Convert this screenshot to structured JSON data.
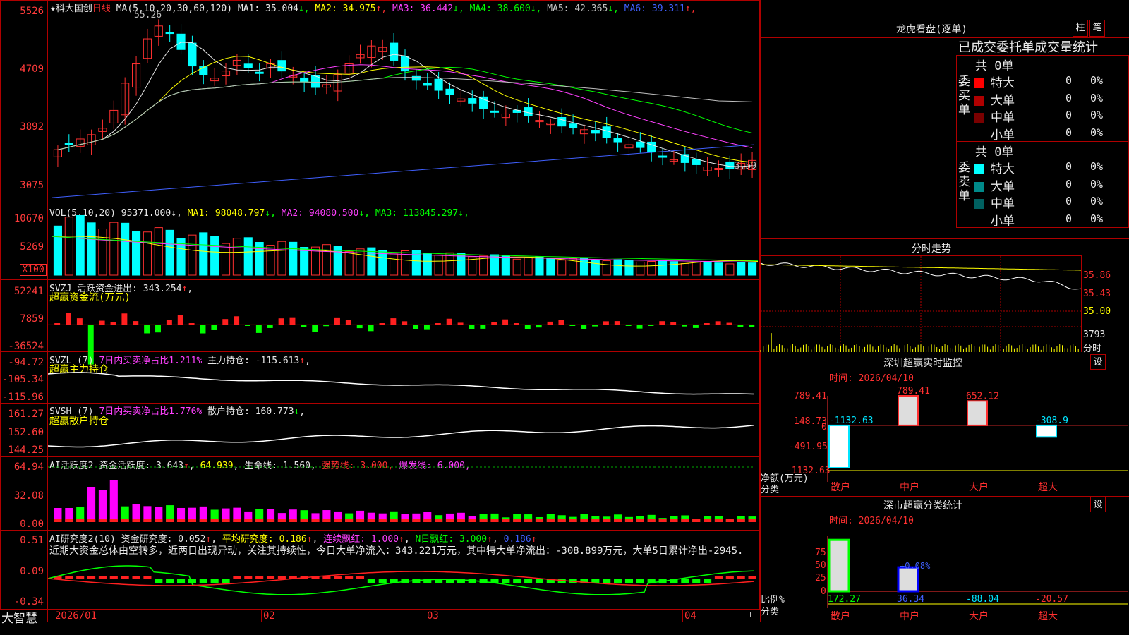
{
  "kline": {
    "star": "★",
    "name": "科大国创",
    "period": "日线",
    "ma_label": "MA(5,10,20,30,60,120)",
    "ma": [
      {
        "label": "MA1:",
        "value": "35.004",
        "arrow": "↓",
        "color": "#e8e8e8"
      },
      {
        "label": "MA2:",
        "value": "34.975",
        "arrow": "↑",
        "color": "#ffff00"
      },
      {
        "label": "MA3:",
        "value": "36.442",
        "arrow": "↓",
        "color": "#ff40ff"
      },
      {
        "label": "MA4:",
        "value": "38.600",
        "arrow": "↓",
        "color": "#00ff00"
      },
      {
        "label": "MA5:",
        "value": "42.365",
        "arrow": "↓",
        "color": "#c0c0c0"
      },
      {
        "label": "MA6:",
        "value": "39.311",
        "arrow": "↑",
        "color": "#4060ff"
      }
    ],
    "high_label": "55.26",
    "low_label": "33.59",
    "y_ticks": [
      "5526",
      "4709",
      "3892",
      "3075"
    ]
  },
  "vol": {
    "label": "VOL(5,10,20)",
    "value": "95371.000",
    "ma": [
      {
        "label": "MA1:",
        "value": "98048.797",
        "arrow": "↓",
        "color": "#ffff00"
      },
      {
        "label": "MA2:",
        "value": "94080.500",
        "arrow": "↓",
        "color": "#ff40ff"
      },
      {
        "label": "MA3:",
        "value": "113845.297",
        "arrow": "↓",
        "color": "#00ff00"
      }
    ],
    "y_ticks": [
      "10670",
      "5269"
    ],
    "unit": "X100"
  },
  "svzj": {
    "label": "SVZJ",
    "text": "活跃资金进出:",
    "value": "343.254",
    "arrow": "↑",
    "subtitle": "超赢资金流(万元)",
    "y_ticks": [
      "52241",
      "7859",
      "-36524"
    ]
  },
  "svzl": {
    "label": "SVZL (7)",
    "text1": "7日内买卖净占比1.211%",
    "text2": "主力持仓:",
    "value": "-115.613",
    "arrow": "↑",
    "subtitle": "超赢主力持仓",
    "y_ticks": [
      "-94.72",
      "-105.34",
      "-115.96"
    ]
  },
  "svsh": {
    "label": "SVSH (7)",
    "text1": "7日内买卖净占比1.776%",
    "text2": "散户持仓:",
    "value": "160.773",
    "arrow": "↓",
    "subtitle": "超赢散户持仓",
    "y_ticks": [
      "161.27",
      "152.60",
      "144.25"
    ]
  },
  "ai_active": {
    "label": "AI活跃度2",
    "text": "资金活跃度:",
    "value": "3.643",
    "arrow": "↑",
    "value2": "64.939",
    "life_label": "生命线:",
    "life_value": "1.560",
    "strong_label": "强势线:",
    "strong_value": "3.000",
    "burst_label": "爆发线:",
    "burst_value": "6.000",
    "y_ticks": [
      "64.94",
      "32.08",
      "0.00"
    ]
  },
  "ai_research": {
    "label": "AI研究度2(10)",
    "t1": "资金研究度:",
    "v1": "0.052",
    "t2": "平均研究度:",
    "v2": "0.186",
    "t3": "连续飘红:",
    "v3": "1.000",
    "t4": "N日飘红:",
    "v4": "3.000",
    "v5": "0.186",
    "comment": "近期大资金总体由空转多，近两日出现异动，关注其持续性，今日大单净流入：343.221万元，其中特大单净流出：-308.899万元，大单5日累计净出-2945.",
    "y_ticks": [
      "0.51",
      "0.09",
      "-0.34"
    ]
  },
  "xaxis": {
    "labels": [
      "2026/01",
      "02",
      "03",
      "04"
    ],
    "brand": "大智慧"
  },
  "longhu": {
    "title": "龙虎看盘(逐单)",
    "btn1": "柱",
    "btn2": "笔",
    "header": "已成交委托单成交量统计",
    "buy_side": "委买单",
    "sell_side": "委卖单",
    "buy_total": "共 0单",
    "sell_total": "共 0单",
    "buy_rows": [
      {
        "name": "特大",
        "num": "0",
        "pct": "0%",
        "color": "#ff0000"
      },
      {
        "name": "大单",
        "num": "0",
        "pct": "0%",
        "color": "#b00000"
      },
      {
        "name": "中单",
        "num": "0",
        "pct": "0%",
        "color": "#7a0000"
      },
      {
        "name": "小单",
        "num": "0",
        "pct": "0%",
        "color": "#000000"
      }
    ],
    "sell_rows": [
      {
        "name": "特大",
        "num": "0",
        "pct": "0%",
        "color": "#00ffff"
      },
      {
        "name": "大单",
        "num": "0",
        "pct": "0%",
        "color": "#008a8a"
      },
      {
        "name": "中单",
        "num": "0",
        "pct": "0%",
        "color": "#006060"
      },
      {
        "name": "小单",
        "num": "0",
        "pct": "0%",
        "color": "#000000"
      }
    ]
  },
  "fenshi": {
    "title": "分时走势",
    "labels": [
      "35.86",
      "35.43",
      "35.00"
    ],
    "vol_label": "3793",
    "unit": "分时"
  },
  "sz_monitor": {
    "title": "深圳超赢实时监控",
    "settings": "设",
    "time_label": "时间: 2026/04/10",
    "y_ticks": [
      "789.41",
      "148.73",
      "-491.95",
      "-1132.63"
    ],
    "zero": "0",
    "left_label1": "净额(万元)",
    "left_label2": "分类",
    "categories": [
      "散户",
      "中户",
      "大户",
      "超大"
    ],
    "chart_data": {
      "type": "bar",
      "categories": [
        "散户",
        "中户",
        "大户",
        "超大"
      ],
      "values": [
        -1132.63,
        789.41,
        652.12,
        -308.9
      ],
      "ylim": [
        -1132.63,
        789.41
      ]
    }
  },
  "sz_classify": {
    "title": "深市超赢分类统计",
    "settings": "设",
    "time_label": "时间: 2026/04/10",
    "y_ticks": [
      "75",
      "50",
      "25",
      "0"
    ],
    "left_label1": "比例%",
    "left_label2": "分类",
    "categories": [
      "散户",
      "中户",
      "大户",
      "超大"
    ],
    "chart_data": {
      "type": "bar",
      "categories": [
        "散户",
        "中户",
        "大户",
        "超大"
      ],
      "values": [
        172.27,
        36.34,
        -88.04,
        -20.57
      ],
      "ylim": [
        0,
        75
      ],
      "bar_label": "+0.08%"
    }
  }
}
